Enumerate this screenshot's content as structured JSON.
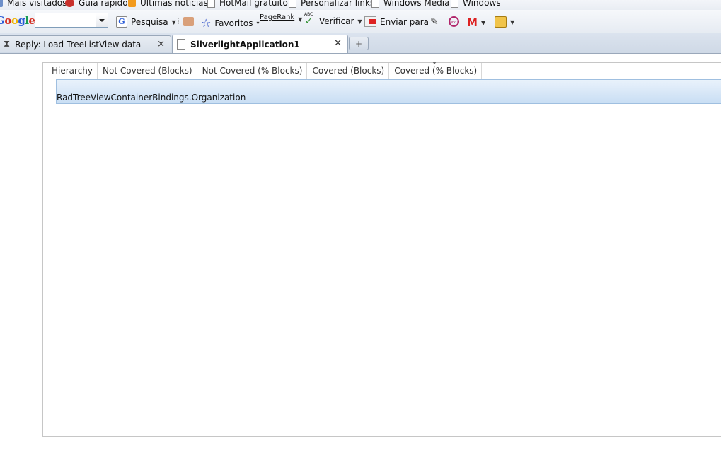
{
  "bookmarks": [
    {
      "label": "Mais visitados",
      "icon": "star-icon"
    },
    {
      "label": "Guia rápido",
      "icon": "firefox-icon"
    },
    {
      "label": "Últimas notícias",
      "icon": "rss-icon"
    },
    {
      "label": "HotMail gratuito",
      "icon": "page-icon"
    },
    {
      "label": "Personalizar links",
      "icon": "page-icon"
    },
    {
      "label": "Windows Media",
      "icon": "page-icon"
    },
    {
      "label": "Windows",
      "icon": "page-icon"
    }
  ],
  "google_toolbar": {
    "logo": "Google",
    "search_value": "",
    "pesquisa_label": "Pesquisa",
    "favoritos_label": "Favoritos",
    "pagerank_label": "PageRank",
    "verificar_label": "Verificar",
    "enviar_label": "Enviar para",
    "spell_icon_text": "ABC",
    "orkut_icon_text": "orkut"
  },
  "tabs": [
    {
      "title": "Reply: Load TreeListView data",
      "active": false
    },
    {
      "title": "SilverlightApplication1",
      "active": true
    }
  ],
  "grid": {
    "columns": [
      "Hierarchy",
      "Not Covered (Blocks)",
      "Not Covered (% Blocks)",
      "Covered (Blocks)",
      "Covered (% Blocks)"
    ],
    "rows": [
      {
        "name": "RadTreeViewContainerBindings.Organization"
      }
    ]
  },
  "colors": {
    "accent": "#2a5bd7",
    "row_selected": "#c9def4"
  }
}
